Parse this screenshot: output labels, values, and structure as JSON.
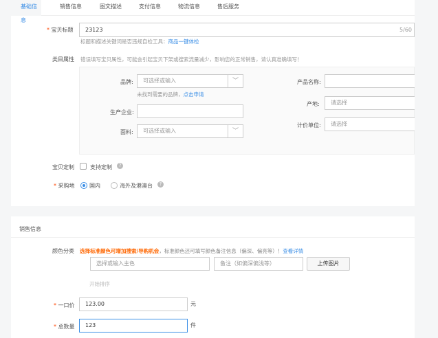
{
  "tabs": [
    {
      "label": "基础信息",
      "active": true
    },
    {
      "label": "销售信息"
    },
    {
      "label": "图文描述"
    },
    {
      "label": "支付信息"
    },
    {
      "label": "物流信息"
    },
    {
      "label": "售后服务"
    }
  ],
  "basic": {
    "title_label": "宝贝标题",
    "title_value": "23123",
    "title_count": "5/60",
    "title_hint": "标题和描述关键词是否违规自检工具：",
    "title_hint_link": "商品一键体检",
    "category_label": "类目属性",
    "category_warning": "错误填写宝贝属性，可能会引起宝贝下架或搜索流量减少，影响您的正常销售，请认真准确填写！",
    "brand_label": "品牌:",
    "brand_placeholder": "可选择或输入",
    "brand_hint": "未找到需要的品牌，",
    "brand_hint_link": "点击申请",
    "maker_label": "生产企业:",
    "fabric_label": "面料:",
    "fabric_placeholder": "可选择或输入",
    "product_name_label": "产品名称:",
    "origin_label": "产地:",
    "origin_placeholder": "请选择",
    "unit_label": "计价单位:",
    "unit_placeholder": "请选择",
    "custom_label": "宝贝定制",
    "custom_option": "支持定制",
    "purchase_label": "采购地",
    "purchase_options": [
      "国内",
      "海外及港澳台"
    ],
    "purchase_selected": "国内"
  },
  "sales": {
    "section_title": "销售信息",
    "color_label": "颜色分类",
    "color_highlight": "选择标准颜色可增加搜索/导购机会",
    "color_note": "，标准颜色还可填写颜色备注信息（偏深、偏亮等）！",
    "color_link": "查看详情",
    "color_placeholder": "选择或输入主色",
    "remark_placeholder": "备注（如偏深偏浅等）",
    "upload_label": "上传图片",
    "sort_label": "开始排序",
    "price_label": "一口价",
    "price_value": "123.00",
    "price_unit": "元",
    "qty_label": "总数量",
    "qty_value": "123",
    "qty_unit": "件"
  },
  "colors": {
    "accent": "#3a8ee6",
    "required": "#ff4400",
    "highlight": "#f60"
  }
}
